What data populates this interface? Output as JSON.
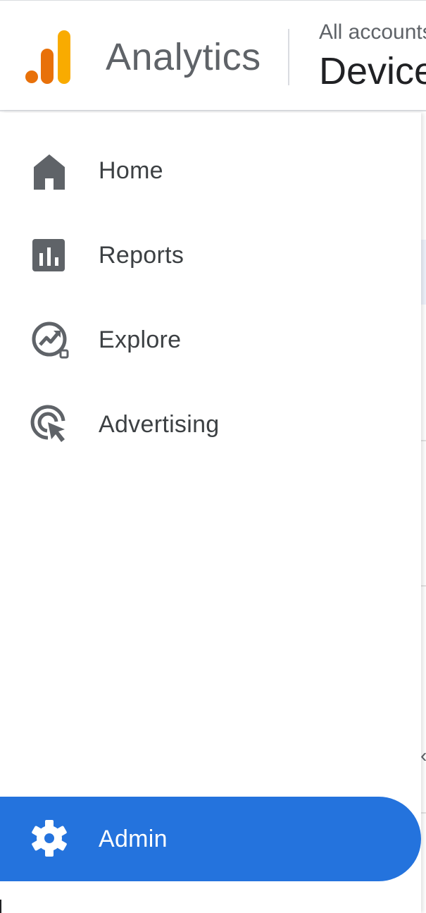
{
  "header": {
    "app_title": "Analytics",
    "account_crumb": "All accounts",
    "property_name": "Device",
    "logo_colors": [
      "#e8710a",
      "#e8710a",
      "#f9ab00"
    ]
  },
  "nav": {
    "items": [
      {
        "label": "Home",
        "icon": "home-icon"
      },
      {
        "label": "Reports",
        "icon": "reports-icon"
      },
      {
        "label": "Explore",
        "icon": "explore-icon"
      },
      {
        "label": "Advertising",
        "icon": "advertising-icon"
      }
    ],
    "admin": {
      "label": "Admin",
      "icon": "gear-icon",
      "selected": true
    }
  },
  "colors": {
    "accent": "#2473dd",
    "icon": "#5f6368",
    "text": "#3c4043",
    "logo_orange": "#e8710a",
    "logo_yellow": "#f9ab00"
  }
}
